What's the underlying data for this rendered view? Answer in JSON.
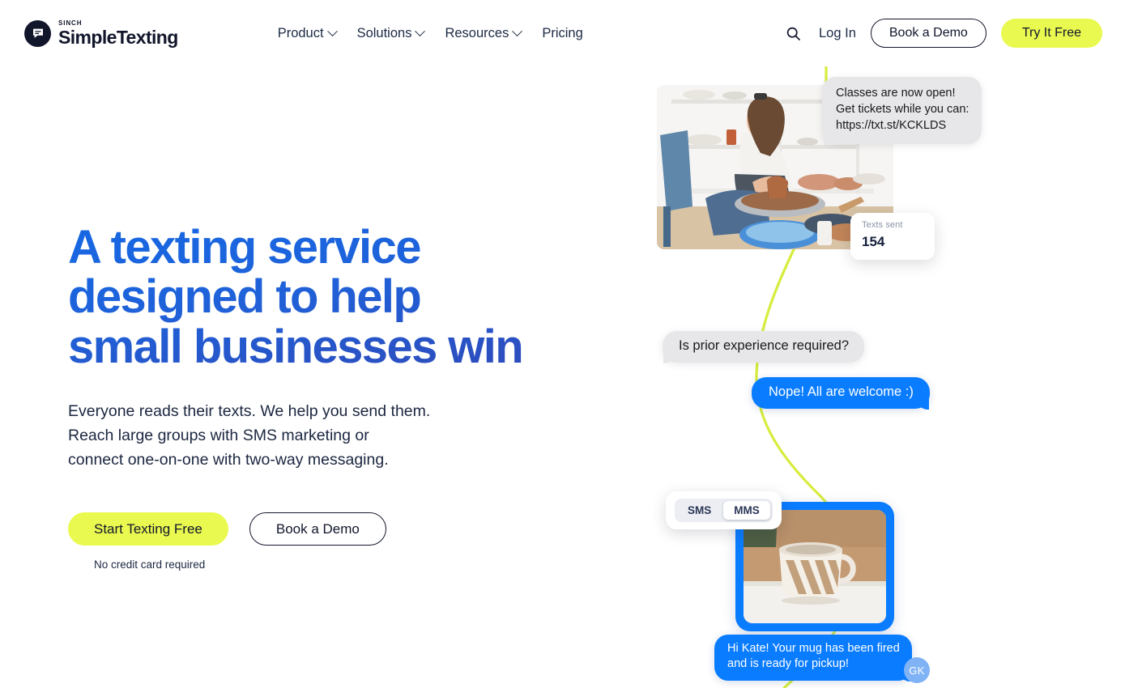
{
  "header": {
    "logo": {
      "sinch": "SINCH",
      "name": "SimpleTexting",
      "icon": "chat-bubble-icon"
    },
    "nav": [
      {
        "label": "Product",
        "has_caret": true
      },
      {
        "label": "Solutions",
        "has_caret": true
      },
      {
        "label": "Resources",
        "has_caret": true
      },
      {
        "label": "Pricing",
        "has_caret": false
      }
    ],
    "search_icon": "search-icon",
    "login": "Log In",
    "book_demo": "Book a Demo",
    "try_free": "Try It Free"
  },
  "hero": {
    "headline": "A texting service\ndesigned to help\nsmall businesses win",
    "subhead": "Everyone reads their texts. We help you send them.\nReach large groups with SMS marketing or\nconnect one-on-one with two-way messaging.",
    "cta_primary": "Start Texting Free",
    "cta_secondary": "Book a Demo",
    "disclaimer": "No credit card required"
  },
  "showcase": {
    "promo_bubble": "Classes are now open!\nGet tickets while you can:\nhttps://txt.st/KCKLDS",
    "stat": {
      "label": "Texts sent",
      "value": "154"
    },
    "message_in": "Is prior experience required?",
    "message_out": "Nope! All are welcome :)",
    "toggle": {
      "sms": "SMS",
      "mms": "MMS",
      "active": "MMS"
    },
    "final_message": "Hi Kate! Your mug has been fired\nand is ready for pickup!",
    "avatar_initials": "GK",
    "photo_alt": "potter-at-wheel-photo",
    "mms_photo_alt": "striped-mug-photo"
  },
  "colors": {
    "lime": "#E9F94F",
    "imessage_blue": "#0a7cff",
    "headline_blue_start": "#1668e3",
    "headline_blue_end": "#2f49b8",
    "bubble_grey": "#e7e7e9",
    "ink": "#12162b"
  }
}
